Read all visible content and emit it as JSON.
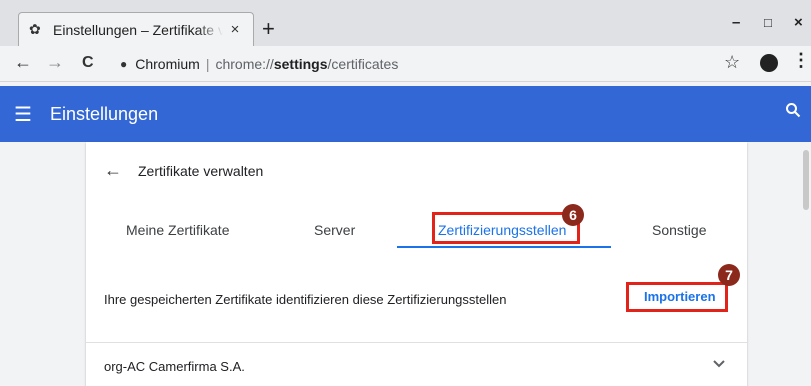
{
  "browser": {
    "tab_title": "Einstellungen – Zertifikate verwalten",
    "tab_close": "×",
    "new_tab": "+",
    "minimize": "–",
    "maximize": "□",
    "close": "×",
    "back": "←",
    "forward": "→",
    "reload": "C",
    "site_name": "Chromium",
    "url_prefix": "chrome://",
    "url_bold": "settings",
    "url_suffix": "/certificates",
    "star": "☆",
    "menu": "⋮"
  },
  "header": {
    "title": "Einstellungen"
  },
  "page": {
    "back_label": "←",
    "title": "Zertifikate verwalten",
    "tabs": [
      {
        "label": "Meine Zertifikate"
      },
      {
        "label": "Server"
      },
      {
        "label": "Zertifizierungsstellen"
      },
      {
        "label": "Sonstige"
      }
    ],
    "info_text": "Ihre gespeicherten Zertifikate identifizieren diese Zertifizierungsstellen",
    "import_label": "Importieren",
    "list": [
      {
        "name": "org-AC Camerfirma S.A."
      }
    ]
  },
  "annotations": {
    "badge_6": "6",
    "badge_7": "7"
  },
  "colors": {
    "header_bg": "#3367d6",
    "accent": "#1a73e8",
    "highlight": "#e2231a",
    "badge": "#8b2a1c"
  }
}
